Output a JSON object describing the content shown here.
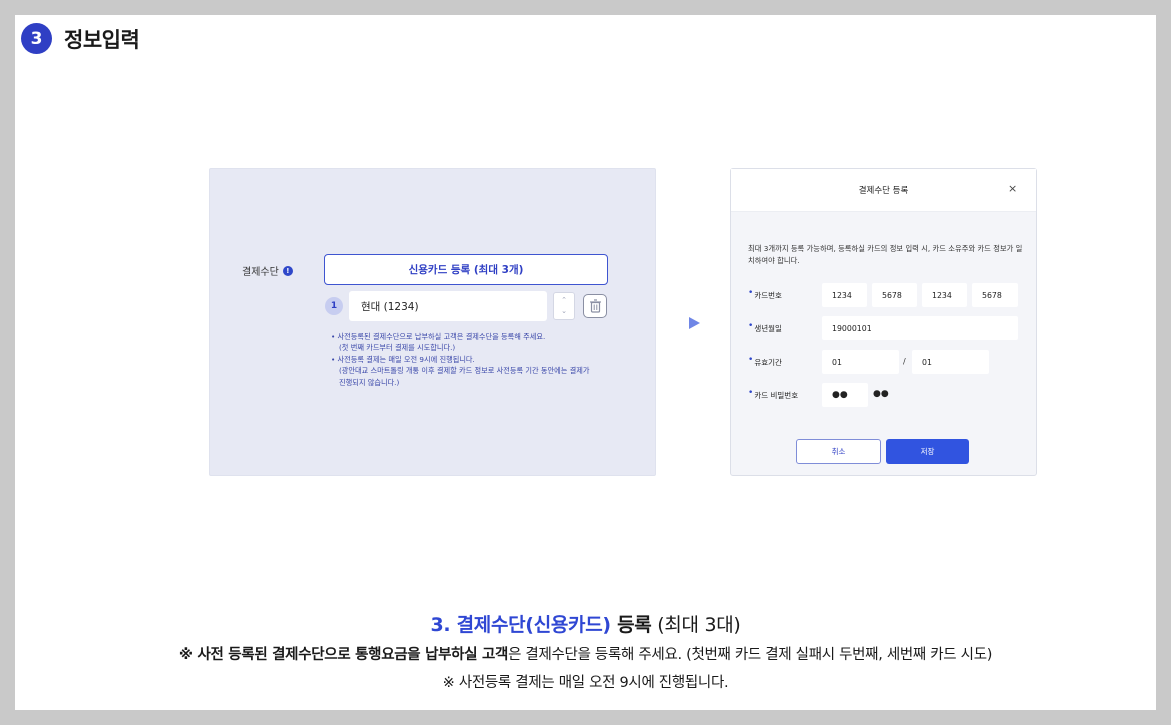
{
  "header": {
    "step_number": "3",
    "title": "정보입력"
  },
  "left_panel": {
    "payment_label": "결제수단",
    "info_icon": "!",
    "register_button": "신용카드 등록 (최대 3개)",
    "card_index": "1",
    "card_value": "현대 (1234)",
    "up_arrow": "⌃",
    "down_arrow": "⌄",
    "notes": [
      "•  사전등록된 결제수단으로 납부하실 고객은 결제수단을 등록해 주세요.",
      "(첫 번째 카드부터 결제를 시도합니다.)",
      "•  사전등록 결제는 매일 오전 9시에 진행됩니다.",
      "(광안대교 스마트톨링 개통 이후 결제할 카드 정보로 사전등록 기간 동안에는 결제가",
      "진행되지 않습니다.)"
    ]
  },
  "dialog": {
    "title": "결제수단 등록",
    "close": "×",
    "description": "최대 3개까지 등록 가능하며, 등록하실 카드의 정보 입력 시, 카드 소유주와 카드 정보가 일치하여야 합니다.",
    "required_mark": "•",
    "card_number_label": "카드번호",
    "card_number": [
      "1234",
      "5678",
      "1234",
      "5678"
    ],
    "birth_label": "생년월일",
    "birth_value": "19000101",
    "expiry_label": "유효기간",
    "expiry_month": "01",
    "expiry_separator": "/",
    "expiry_year": "01",
    "password_label": "카드 비밀번호",
    "password_value": "●●",
    "password_fixed": "●●",
    "cancel_button": "취소",
    "save_button": "저장"
  },
  "caption": {
    "title_prefix": "3. 결제수단(신용카드)",
    "title_mid": " 등록",
    "title_suffix": " (최대 3대)",
    "line1_bold": "※ 사전 등록된 결제수단으로 통행요금을 납부하실 고객",
    "line1_rest": "은 결제수단을 등록해 주세요. (첫번째 카드 결제 실패시 두번째, 세번째 카드 시도)",
    "line2": "※ 사전등록 결제는 매일 오전 9시에 진행됩니다."
  },
  "colors": {
    "accent": "#2f47d3",
    "panel_bg": "#e7e9f4",
    "button_blue": "#3154e0"
  }
}
